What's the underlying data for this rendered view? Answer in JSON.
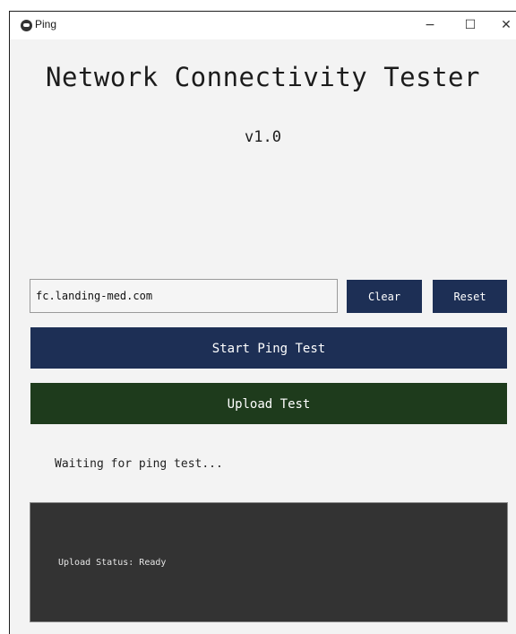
{
  "window": {
    "title": "Ping",
    "controls": {
      "minimize": "−",
      "maximize": "☐",
      "close": "✕"
    }
  },
  "header": {
    "title": "Network Connectivity Tester",
    "version": "v1.0"
  },
  "host_input": {
    "value": "fc.landing-med.com",
    "placeholder": ""
  },
  "buttons": {
    "clear": "Clear",
    "reset": "Reset",
    "start_ping": "Start Ping Test",
    "upload_test": "Upload Test"
  },
  "status": {
    "ping": "Waiting for ping test...",
    "upload": "Upload Status: Ready"
  },
  "colors": {
    "window_bg": "#f3f3f3",
    "primary_button": "#1d2f55",
    "upload_button": "#1e3b1c",
    "upload_panel": "#333333"
  },
  "icons": {
    "app": "app-logo-icon"
  }
}
